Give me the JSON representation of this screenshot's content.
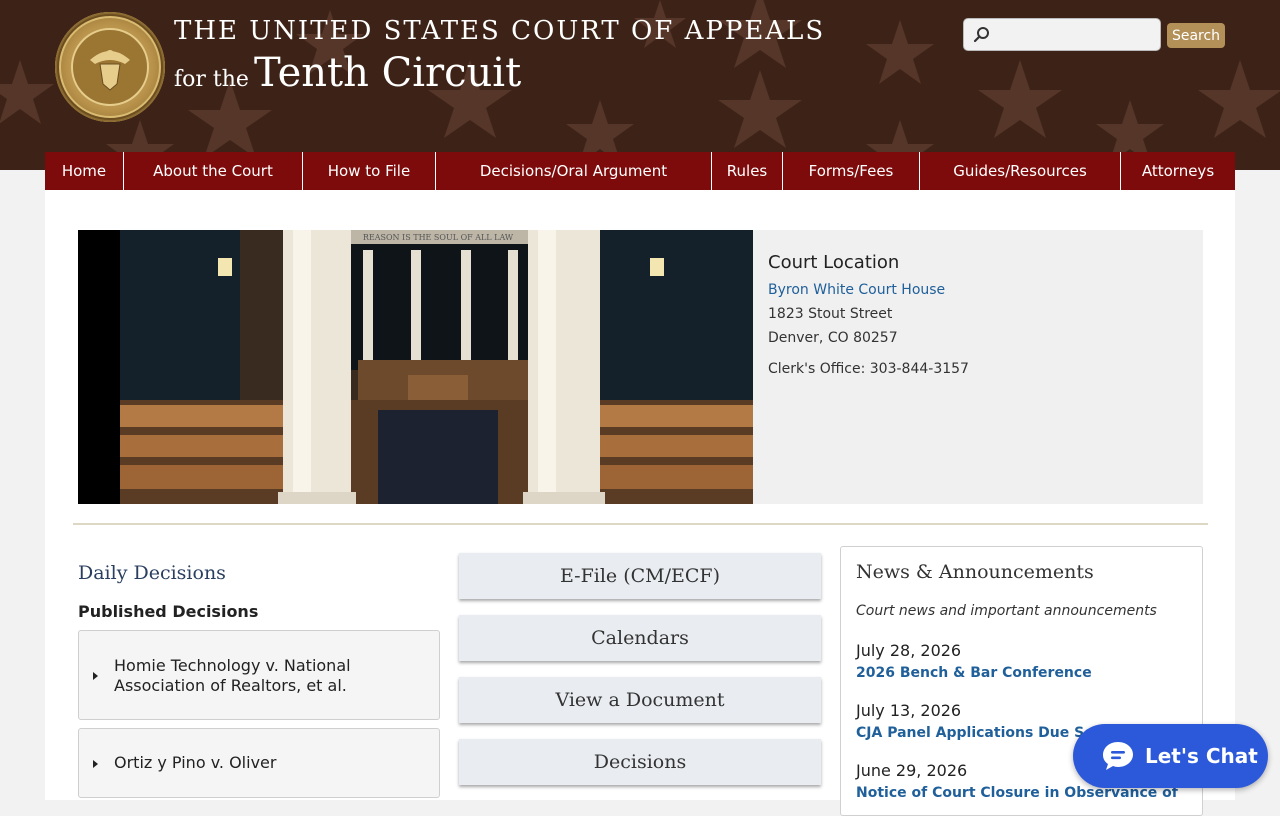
{
  "header": {
    "title_top": "THE UNITED STATES COURT OF APPEALS",
    "title_prefix": "for the",
    "title_main": "Tenth Circuit",
    "seal_text": "UNITED STATES COURT OF APPEALS TENTH CIRCUIT",
    "search": {
      "placeholder": "",
      "value": "",
      "button_label": "Search"
    }
  },
  "nav": [
    {
      "label": "Home"
    },
    {
      "label": "About the Court"
    },
    {
      "label": "How to File"
    },
    {
      "label": "Decisions/Oral Argument"
    },
    {
      "label": "Rules"
    },
    {
      "label": "Forms/Fees"
    },
    {
      "label": "Guides/Resources"
    },
    {
      "label": "Attorneys"
    }
  ],
  "hero": {
    "inscription": "REASON IS THE SOUL OF ALL LAW"
  },
  "location": {
    "heading": "Court Location",
    "link": "Byron White Court House",
    "street": "1823 Stout Street",
    "city": "Denver, CO 80257",
    "phone": "Clerk's Office: 303-844-3157"
  },
  "decisions": {
    "heading": "Daily Decisions",
    "subheading": "Published Decisions",
    "items": [
      {
        "title": "Homie Technology v. National Association of Realtors, et al."
      },
      {
        "title": "Ortiz y Pino v. Oliver"
      }
    ]
  },
  "tiles": [
    {
      "label": "E-File (CM/ECF)"
    },
    {
      "label": "Calendars"
    },
    {
      "label": "View a Document"
    },
    {
      "label": "Decisions"
    }
  ],
  "news": {
    "heading": "News & Announcements",
    "subheading": "Court news and important announcements",
    "items": [
      {
        "date": "July 28, 2026",
        "title": "2026 Bench & Bar Conference"
      },
      {
        "date": "July 13, 2026",
        "title": "CJA Panel Applications Due Septe"
      },
      {
        "date": "June 29, 2026",
        "title": "Notice of Court Closure in Observance of"
      }
    ]
  },
  "chat": {
    "label": "Let's Chat"
  },
  "icons": {
    "search": "search-icon",
    "chat": "chat-bubble-icon",
    "expand": "caret-right-icon",
    "seal": "court-seal"
  },
  "colors": {
    "header_bg": "#3d2317",
    "nav_bg": "#7e0b0b",
    "search_button": "#b39058",
    "link": "#1f5f9a",
    "chat": "#2b59d9"
  }
}
